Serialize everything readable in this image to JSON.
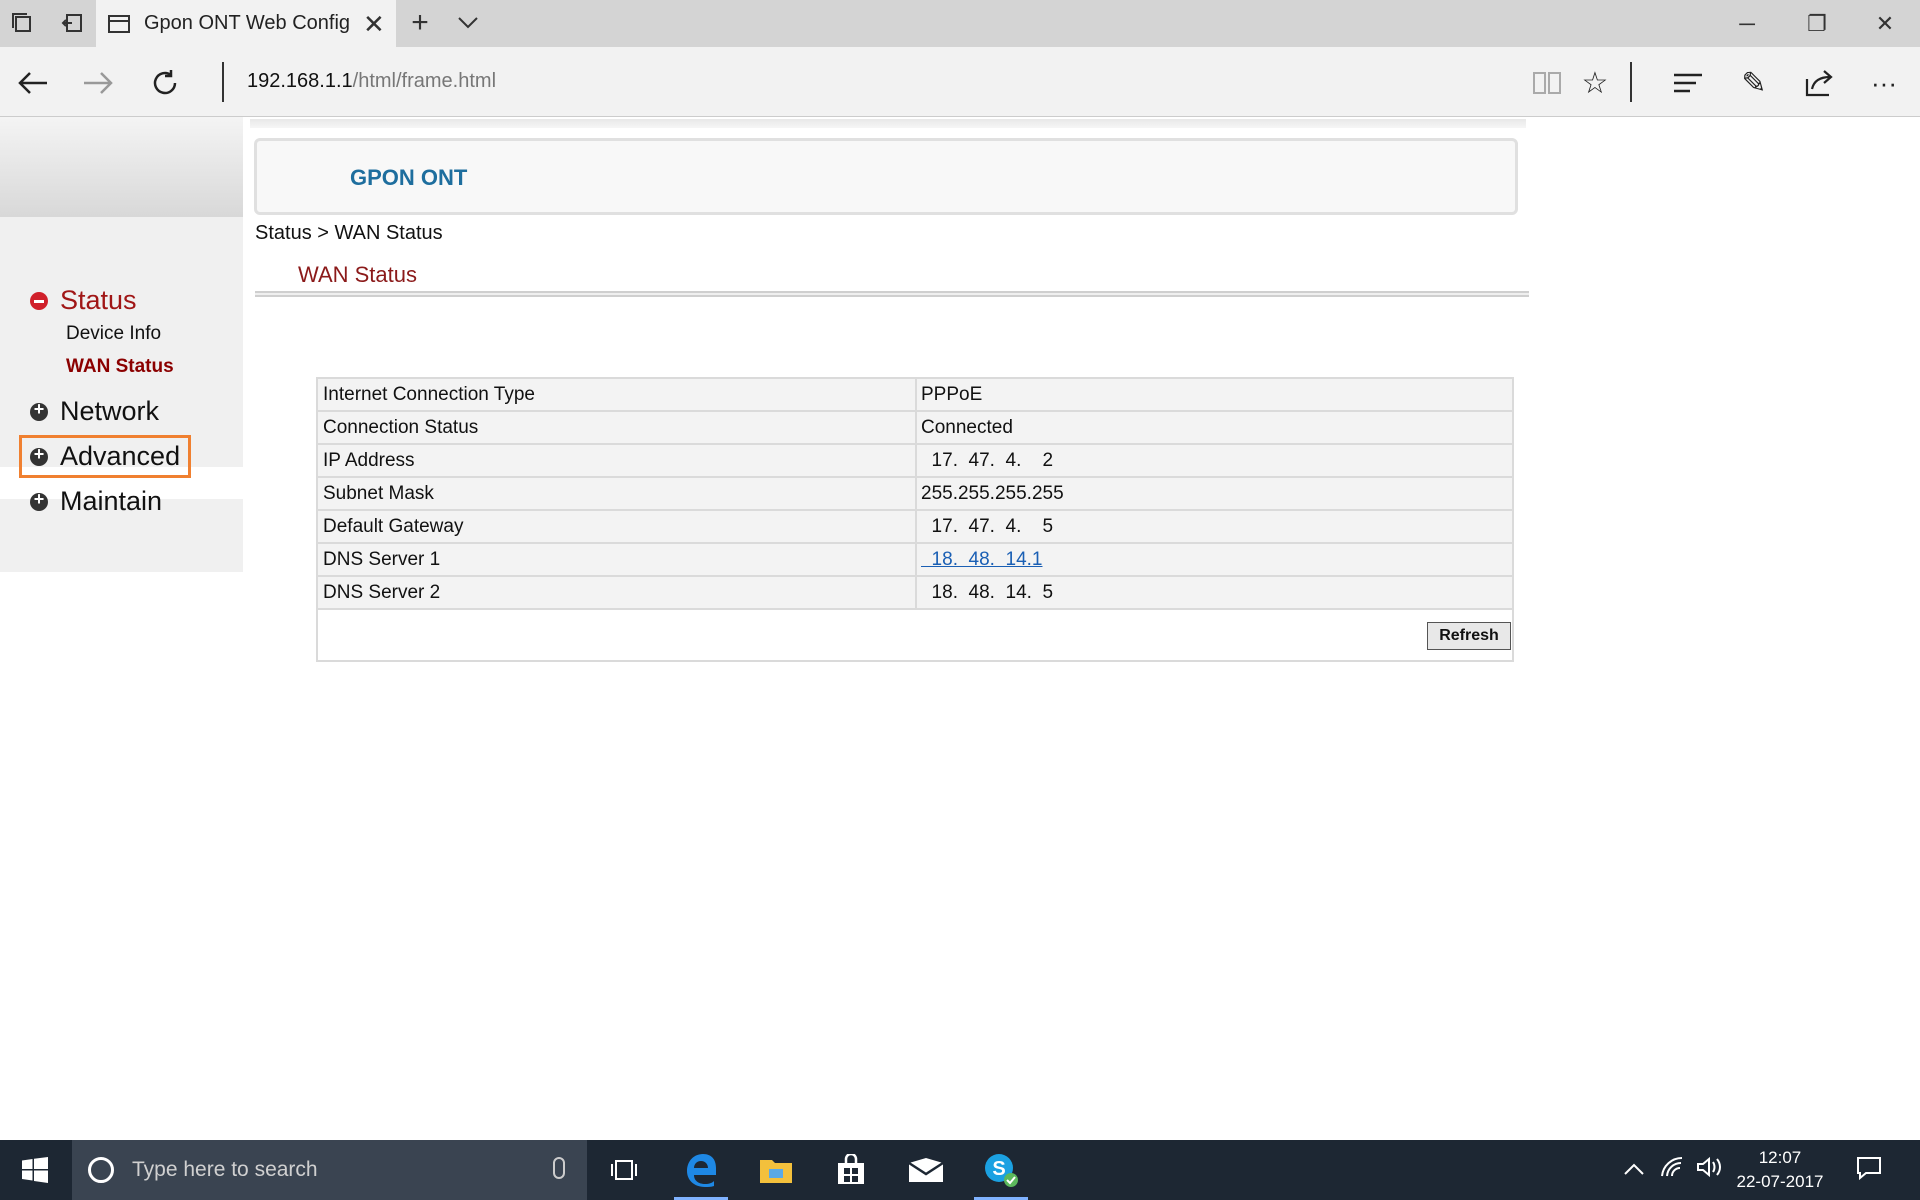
{
  "browser": {
    "tab_title": "Gpon ONT Web Configuration",
    "url_host": "192.168.1.1",
    "url_path": "/html/frame.html",
    "icons": [
      "tab-preview-icon",
      "back-tabs-icon",
      "page-icon",
      "close-icon",
      "new-tab-icon",
      "tab-list-chevron-icon",
      "back-icon",
      "forward-icon",
      "refresh-icon",
      "reading-view-icon",
      "favorite-star-icon",
      "hub-icon",
      "notes-pen-icon",
      "share-icon",
      "more-icon"
    ]
  },
  "header": {
    "title": "GPON ONT"
  },
  "breadcrumb": "Status > WAN Status",
  "section_title": "WAN Status",
  "menu": {
    "status": "Status",
    "device_info": "Device Info",
    "wan_status": "WAN Status",
    "network": "Network",
    "advanced": "Advanced",
    "maintain": "Maintain"
  },
  "wan": {
    "rows": [
      {
        "label": "Internet Connection Type",
        "value": "PPPoE"
      },
      {
        "label": "Connection Status",
        "value": "Connected"
      },
      {
        "label": "IP Address",
        "value": "  17.  47.  4.    2"
      },
      {
        "label": "Subnet Mask",
        "value": "255.255.255.255"
      },
      {
        "label": "Default Gateway",
        "value": "  17.  47.  4.    5"
      },
      {
        "label": "DNS Server 1",
        "value": "  18.  48.  14.1"
      },
      {
        "label": "DNS Server 2",
        "value": "  18.  48.  14.  5"
      }
    ],
    "refresh_label": "Refresh"
  },
  "taskbar": {
    "search_placeholder": "Type here to search",
    "time": "12:07",
    "date": "22-07-2017"
  },
  "colors": {
    "header_title": "#1e6e9e",
    "section_title": "#8b1a1a",
    "highlight_border": "#f08030",
    "link": "#1a5fb4"
  }
}
